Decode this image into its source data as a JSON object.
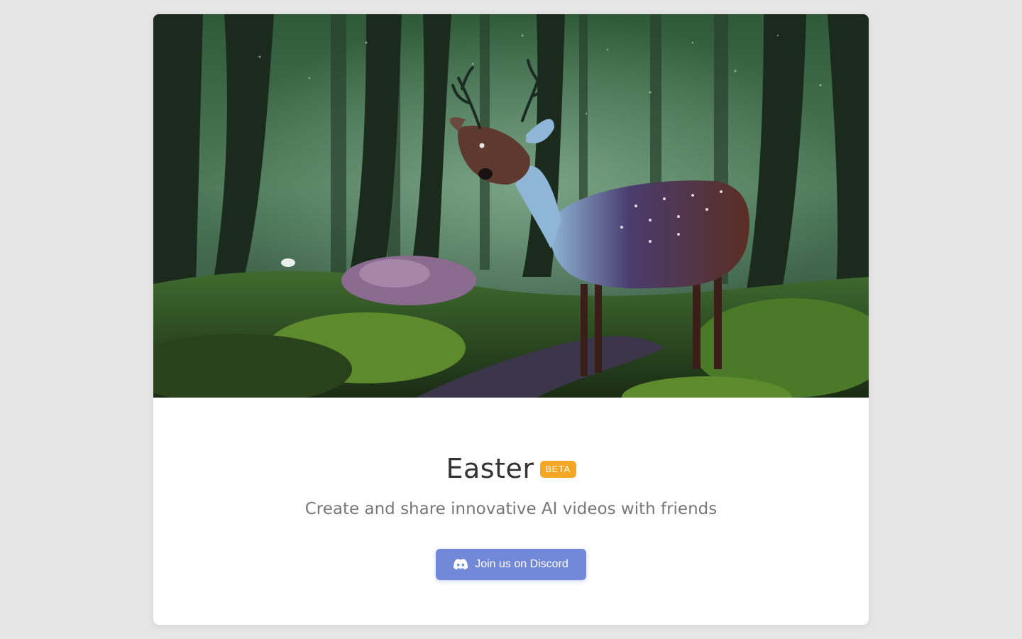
{
  "hero": {
    "image_description": "",
    "icon": "forest-deer-illustration"
  },
  "title": {
    "name": "Easter",
    "badge": "BETA",
    "badge_color": "#f5a623"
  },
  "subtitle": "Create and share innovative AI videos with friends",
  "discord_button": {
    "label": "Join us on Discord",
    "icon": "discord-icon",
    "color": "#7289da"
  },
  "colors": {
    "background": "#e6e6e6",
    "card": "#ffffff",
    "title_text": "#333333",
    "subtitle_text": "#777777"
  }
}
